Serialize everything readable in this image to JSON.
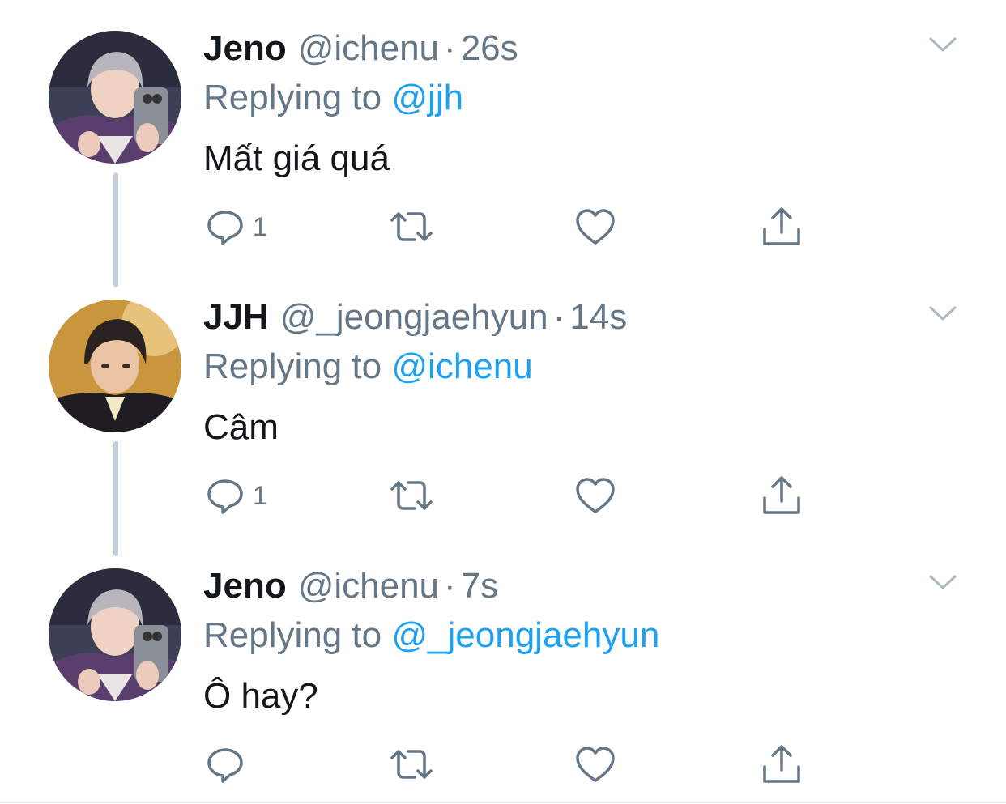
{
  "tweets": [
    {
      "name": "Jeno",
      "handle": "@ichenu",
      "separator": "·",
      "time": "26s",
      "reply_prefix": "Replying to",
      "reply_to": "@jjh",
      "text": "Mất giá quá",
      "reply_count": "1",
      "avatar": "avatar-jeno"
    },
    {
      "name": "JJH",
      "handle": "@_jeongjaehyun",
      "separator": "·",
      "time": "14s",
      "reply_prefix": "Replying to",
      "reply_to": "@ichenu",
      "text": "Câm",
      "reply_count": "1",
      "avatar": "avatar-jjh"
    },
    {
      "name": "Jeno",
      "handle": "@ichenu",
      "separator": "·",
      "time": "7s",
      "reply_prefix": "Replying to",
      "reply_to": "@_jeongjaehyun",
      "text": "Ô hay?",
      "reply_count": "",
      "avatar": "avatar-jeno"
    }
  ],
  "icons": {
    "reply": "reply-icon",
    "retweet": "retweet-icon",
    "like": "heart-icon",
    "share": "share-icon",
    "more": "chevron-down-icon"
  },
  "colors": {
    "text": "#14171a",
    "secondary": "#657786",
    "mention": "#1da1f2",
    "thread_line": "#c4ced8"
  }
}
